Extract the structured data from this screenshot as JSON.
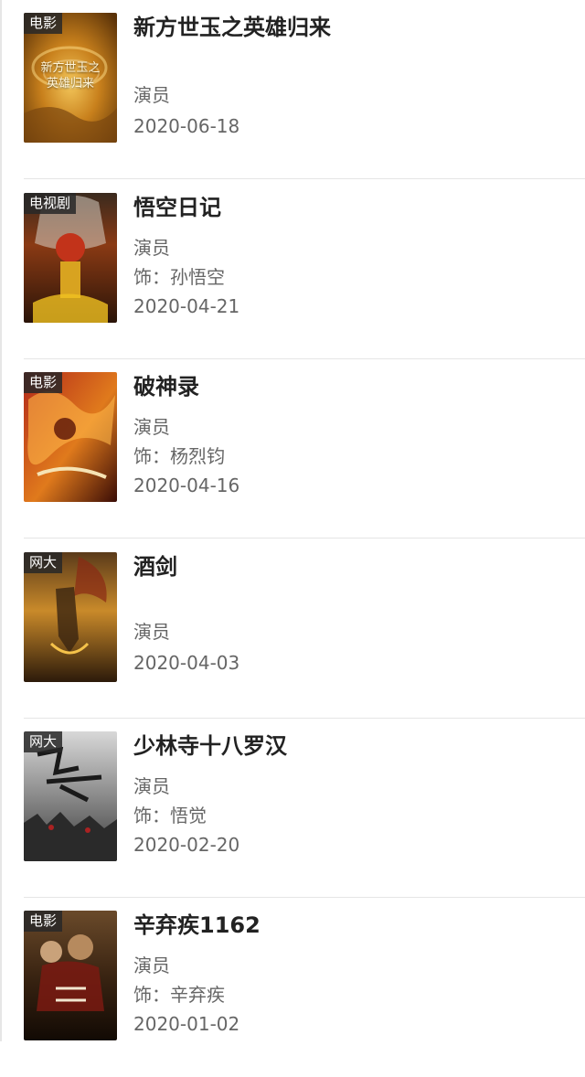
{
  "items": [
    {
      "badge": "电影",
      "title": "新方世玉之英雄归来",
      "role": "演员",
      "character": "",
      "date": "2020-06-18",
      "poster_caption": "新方世玉之\n英雄归来"
    },
    {
      "badge": "电视剧",
      "title": "悟空日记",
      "role": "演员",
      "character": "饰：孙悟空",
      "date": "2020-04-21"
    },
    {
      "badge": "电影",
      "title": "破神录",
      "role": "演员",
      "character": "饰：杨烈钧",
      "date": "2020-04-16"
    },
    {
      "badge": "网大",
      "title": "酒剑",
      "role": "演员",
      "character": "",
      "date": "2020-04-03"
    },
    {
      "badge": "网大",
      "title": "少林寺十八罗汉",
      "role": "演员",
      "character": "饰：悟觉",
      "date": "2020-02-20"
    },
    {
      "badge": "电影",
      "title": "辛弃疾1162",
      "role": "演员",
      "character": "饰：辛弃疾",
      "date": "2020-01-02"
    }
  ]
}
